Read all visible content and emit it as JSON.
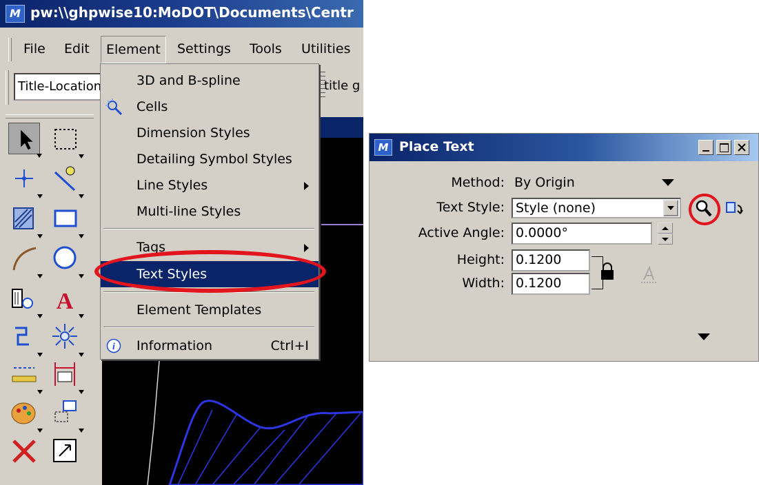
{
  "main_window": {
    "title": "pw:\\\\ghpwise10:MoDOT\\Documents\\Centr",
    "menu": [
      {
        "label": "File"
      },
      {
        "label": "Edit"
      },
      {
        "label": "Element"
      },
      {
        "label": "Settings"
      },
      {
        "label": "Tools"
      },
      {
        "label": "Utilities"
      }
    ],
    "level_value": "Title-Location",
    "title_fragment": "title g"
  },
  "element_menu": {
    "items": [
      {
        "label": "3D and B-spline"
      },
      {
        "label": "Cells"
      },
      {
        "label": "Dimension Styles"
      },
      {
        "label": "Detailing Symbol Styles"
      },
      {
        "label": "Line Styles"
      },
      {
        "label": "Multi-line Styles"
      },
      {
        "label": "Tags"
      },
      {
        "label": "Text Styles"
      },
      {
        "label": "Element Templates"
      },
      {
        "label": "Information",
        "shortcut": "Ctrl+I"
      }
    ],
    "highlighted": "Text Styles",
    "annotation_color": "#e2141d"
  },
  "place_text": {
    "title": "Place Text",
    "method_label": "Method:",
    "method_value": "By Origin",
    "text_style_label": "Text Style:",
    "text_style_value": "Style (none)",
    "active_angle_label": "Active Angle:",
    "active_angle_value": "0.0000°",
    "height_label": "Height:",
    "height_value": "0.1200",
    "width_label": "Width:",
    "width_value": "0.1200"
  }
}
